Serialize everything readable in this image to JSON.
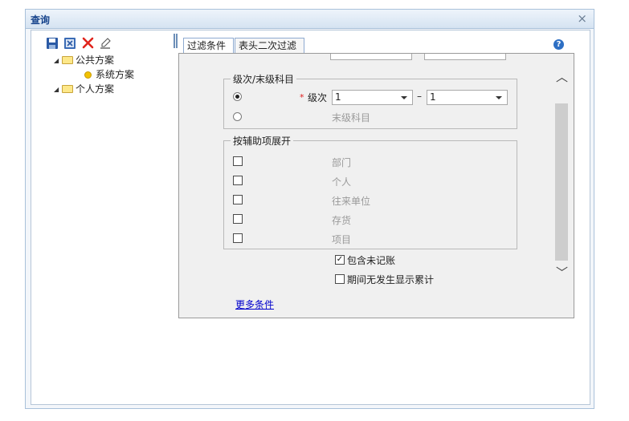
{
  "window": {
    "title": "查询",
    "close_glyph": "×"
  },
  "toolbar": {
    "icons": [
      "save-icon",
      "save-as-icon",
      "delete-icon",
      "edit-icon"
    ]
  },
  "tree": {
    "public_label": "公共方案",
    "system_label": "系统方案",
    "personal_label": "个人方案"
  },
  "tabs": [
    "过滤条件",
    "表头二次过滤"
  ],
  "help_glyph": "?",
  "level_group": {
    "title": "级次/末级科目",
    "level_label": "级次",
    "required_mark": "*",
    "level_from": "1",
    "dash": "–",
    "level_to": "1",
    "last_level_label": "末级科目",
    "selected": "level"
  },
  "aux_group": {
    "title": "按辅助项展开",
    "items": [
      "部门",
      "个人",
      "往来单位",
      "存货",
      "项目"
    ]
  },
  "options": {
    "include_unposted": "包含未记账",
    "include_unposted_checked": true,
    "show_cumulative": "期间无发生显示累计",
    "show_cumulative_checked": false
  },
  "more_link": "更多条件",
  "colors": {
    "accent": "#15428b",
    "link": "#0000cc",
    "panel_bg": "#f0f0f0"
  }
}
